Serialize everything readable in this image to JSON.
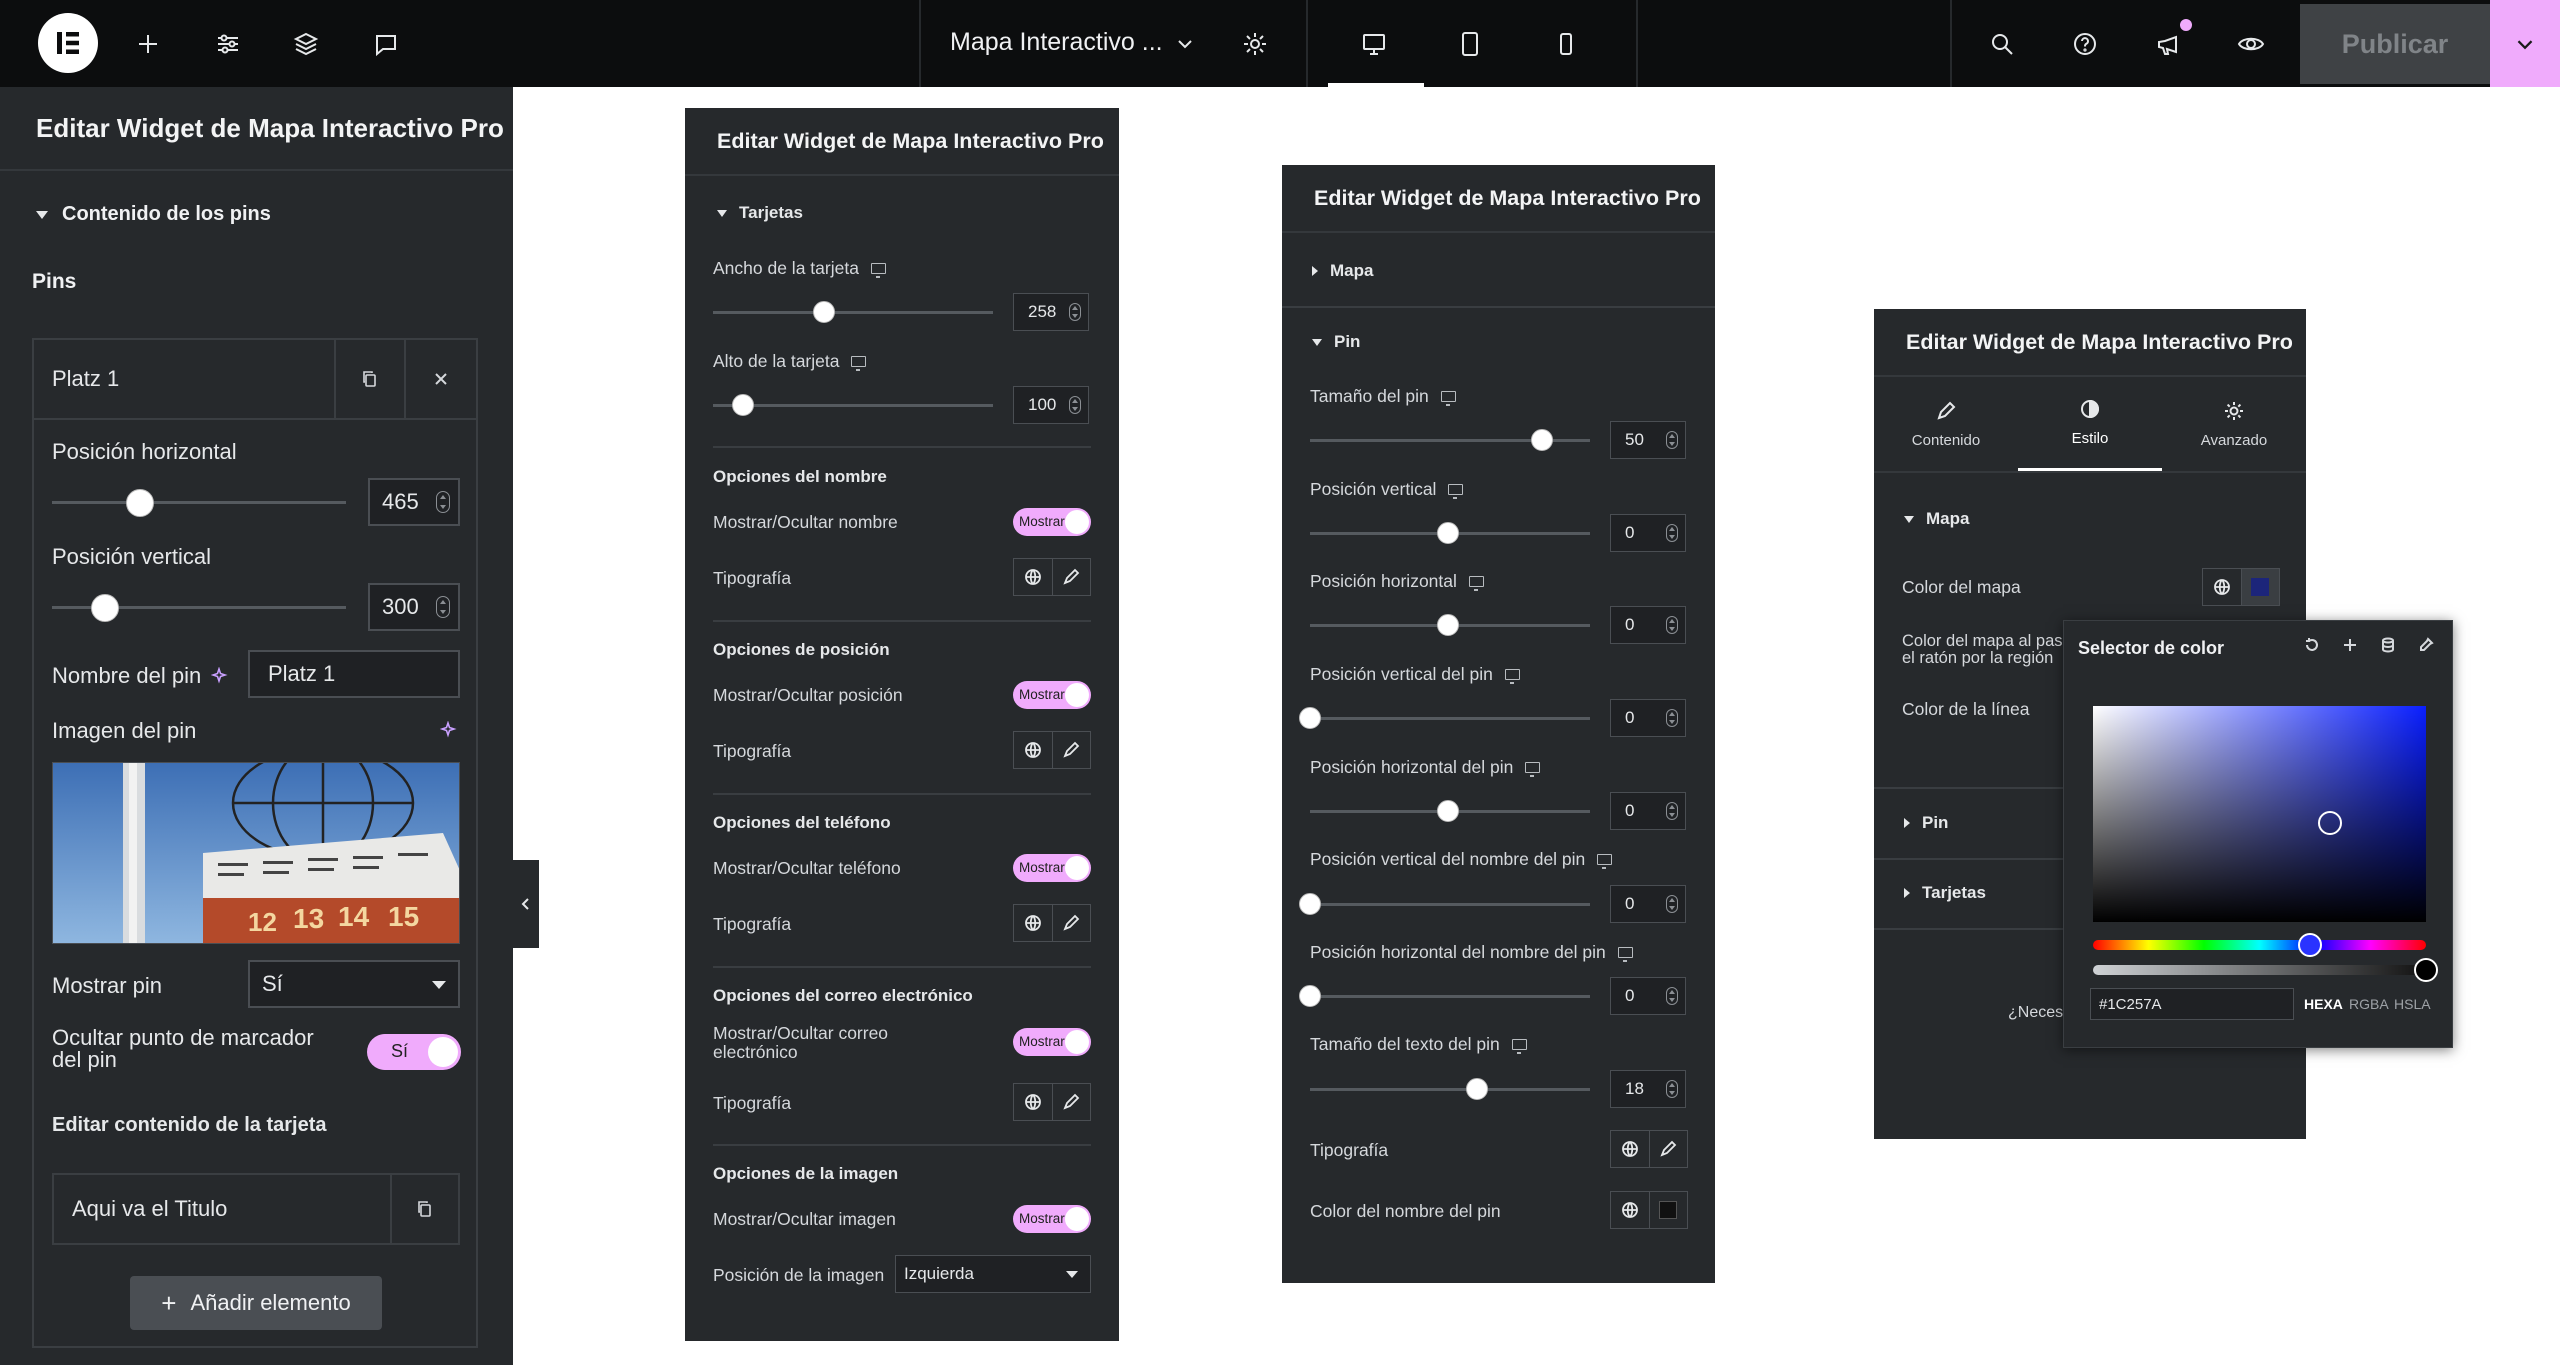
{
  "topbar": {
    "page_title": "Mapa Interactivo ...",
    "publish_label": "Publicar"
  },
  "sidebar": {
    "header": "Editar Widget de Mapa Interactivo Pro",
    "section": "Contenido de los pins",
    "pins_label": "Pins",
    "item_title": "Platz 1",
    "pos_h_label": "Posición horizontal",
    "pos_h_value": "465",
    "pos_h_level": 0.3,
    "pos_v_label": "Posición vertical",
    "pos_v_value": "300",
    "pos_v_level": 0.18,
    "pin_name_label": "Nombre del pin",
    "pin_name_value": "Platz 1",
    "pin_image_label": "Imagen del pin",
    "show_pin_label": "Mostrar pin",
    "show_pin_value": "Sí",
    "hide_marker_label": "Ocultar punto de marcador del pin",
    "hide_marker_value": "Sí",
    "card_content_label": "Editar contenido de la tarjeta",
    "card_item_title": "Aqui va el Titulo",
    "add_button": "Añadir elemento"
  },
  "panel1": {
    "header": "Editar Widget de Mapa Interactivo Pro",
    "section": "Tarjetas",
    "card_width_label": "Ancho de la tarjeta",
    "card_width_value": "258",
    "card_height_label": "Alto de la tarjeta",
    "card_height_value": "100",
    "name_group": "Opciones del nombre",
    "name_toggle_label": "Mostrar/Ocultar nombre",
    "position_group": "Opciones de posición",
    "position_toggle_label": "Mostrar/Ocultar posición",
    "phone_group": "Opciones del teléfono",
    "phone_toggle_label": "Mostrar/Ocultar teléfono",
    "email_group": "Opciones del correo electrónico",
    "email_toggle_label": "Mostrar/Ocultar correo electrónico",
    "image_group": "Opciones de la imagen",
    "image_toggle_label": "Mostrar/Ocultar imagen",
    "image_position_label": "Posición de la imagen",
    "image_position_value": "Izquierda",
    "typography_label": "Tipografía",
    "toggle_text": "Mostrar"
  },
  "panel2": {
    "header": "Editar Widget de Mapa Interactivo Pro",
    "section_map": "Mapa",
    "section_pin": "Pin",
    "pin_size_label": "Tamaño del pin",
    "pin_size_value": "50",
    "pos_v_label": "Posición vertical",
    "pos_v_value": "0",
    "pos_h_label": "Posición horizontal",
    "pos_h_value": "0",
    "pin_pos_v_label": "Posición vertical del pin",
    "pin_pos_v_value": "0",
    "pin_pos_h_label": "Posición horizontal del pin",
    "pin_pos_h_value": "0",
    "name_pos_v_label": "Posición vertical del nombre del pin",
    "name_pos_v_value": "0",
    "name_pos_h_label": "Posición horizontal del nombre del pin",
    "name_pos_h_value": "0",
    "text_size_label": "Tamaño del texto del pin",
    "text_size_value": "18",
    "typography_label": "Tipografía",
    "name_color_label": "Color del nombre del pin"
  },
  "panel3": {
    "header": "Editar Widget de Mapa Interactivo Pro",
    "tabs": [
      {
        "label": "Contenido",
        "icon": "pencil-icon"
      },
      {
        "label": "Estilo",
        "icon": "contrast-icon"
      },
      {
        "label": "Avanzado",
        "icon": "gear-icon"
      }
    ],
    "section_map": "Mapa",
    "map_color_label": "Color del mapa",
    "hover_color_label": "Color del mapa al pasar el ratón por la región",
    "line_color_label": "Color de la línea",
    "section_pin": "Pin",
    "section_cards": "Tarjetas",
    "help_text": "¿Necesitas ayuda?",
    "map_color": "#1C257A"
  },
  "picker": {
    "title": "Selector de color",
    "hex_value": "#1C257A",
    "formats": [
      "HEXA",
      "RGBA",
      "HSLA"
    ]
  }
}
